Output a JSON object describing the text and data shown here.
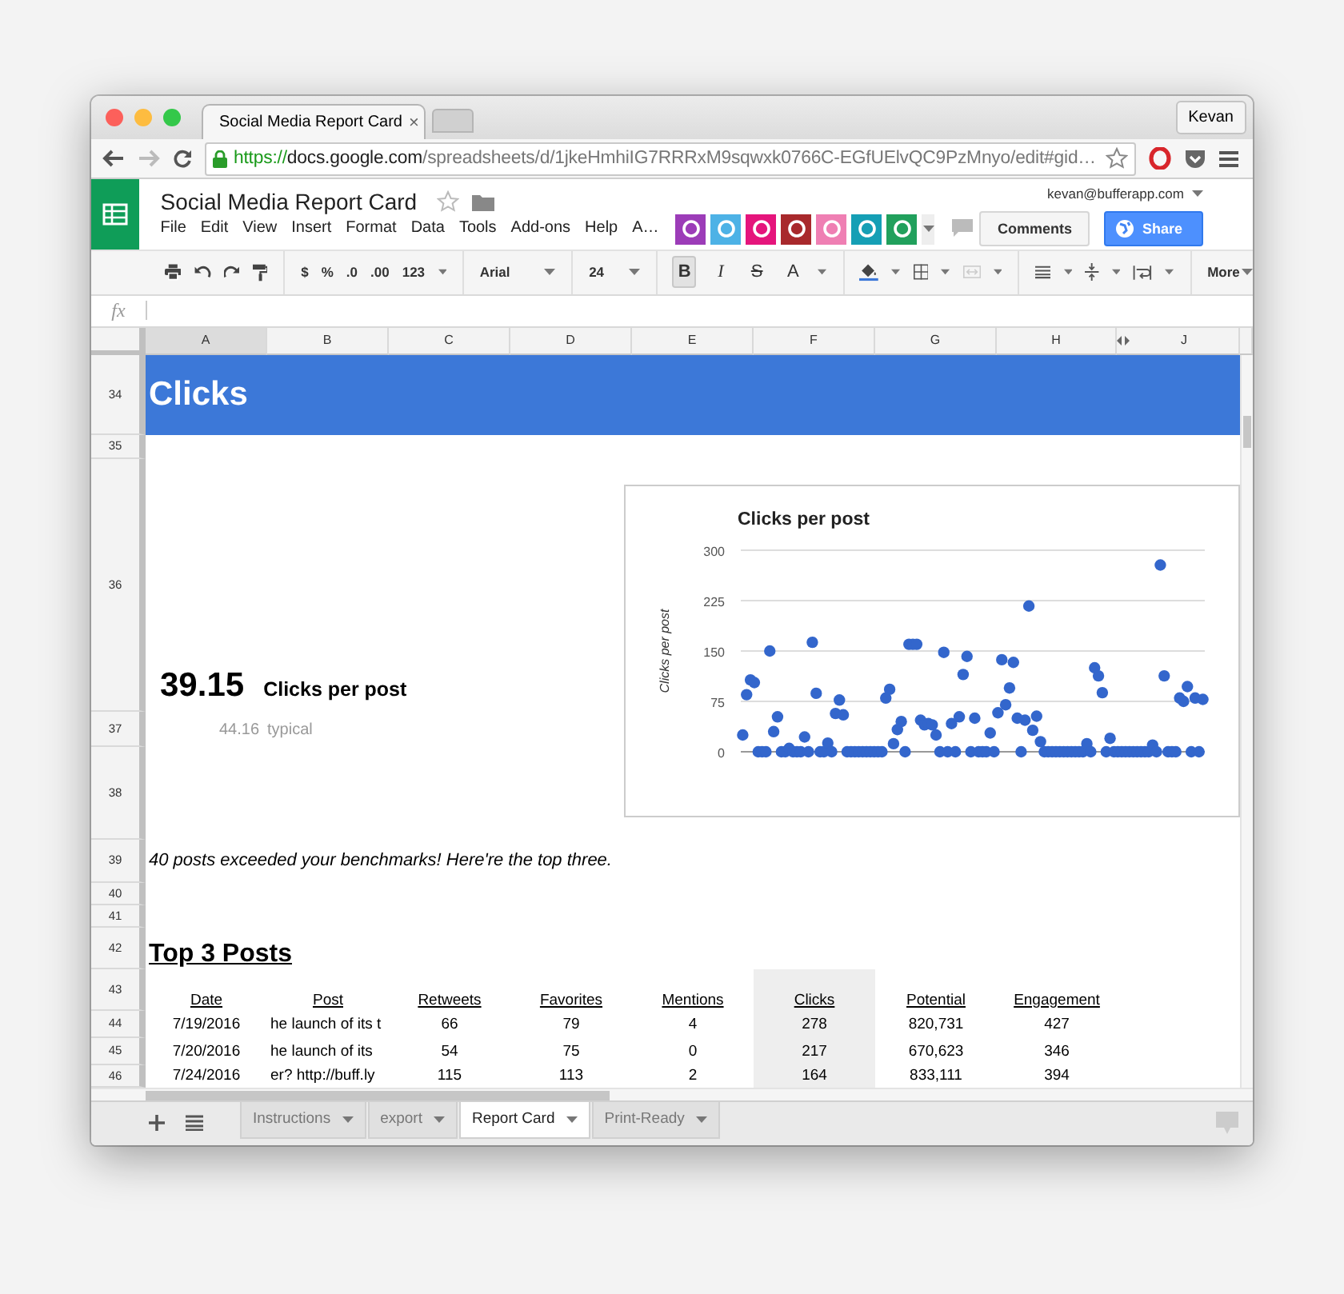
{
  "browser": {
    "tab_title": "Social Media Report Card",
    "tab_close": "×",
    "profile": "Kevan",
    "url": {
      "scheme": "https://",
      "host": "docs.google.com",
      "path": "/spreadsheets/d/1jkeHmhiIG7RRRxM9sqwxk0766C-EGfUElvQC9PzMnyo/edit#gid…"
    }
  },
  "doc": {
    "title": "Social Media Report Card",
    "account": "kevan@bufferapp.com",
    "menu": [
      "File",
      "Edit",
      "View",
      "Insert",
      "Format",
      "Data",
      "Tools",
      "Add-ons",
      "Help",
      "A…"
    ],
    "addons": [
      {
        "color": "#9c3cb8"
      },
      {
        "color": "#4db2e6"
      },
      {
        "color": "#e5157c"
      },
      {
        "color": "#a8292c"
      },
      {
        "color": "#ef7fb3"
      },
      {
        "color": "#159fb5"
      },
      {
        "color": "#21a05c"
      }
    ],
    "buttons": [
      {
        "label": "Comments",
        "kind": "plain"
      },
      {
        "label": "Share",
        "kind": "primary"
      }
    ]
  },
  "toolbar": {
    "number_formats": [
      "$",
      "%",
      ".0",
      ".00",
      "123"
    ],
    "font": "Arial",
    "font_size": "24",
    "text_styles": [
      {
        "kind": "bold",
        "label": "B",
        "on": true
      },
      {
        "kind": "italic",
        "label": "I",
        "on": false
      },
      {
        "kind": "strike",
        "label": "S",
        "on": false
      },
      {
        "kind": "color",
        "label": "A",
        "on": false
      }
    ],
    "more": "More"
  },
  "formula_bar": {
    "label": "fx"
  },
  "columns": [
    {
      "label": "A",
      "selected": true
    },
    {
      "label": "B",
      "selected": false
    },
    {
      "label": "C",
      "selected": false
    },
    {
      "label": "D",
      "selected": false
    },
    {
      "label": "E",
      "selected": false
    },
    {
      "label": "F",
      "selected": false
    },
    {
      "label": "G",
      "selected": false
    },
    {
      "label": "H",
      "selected": false
    },
    {
      "label": "J",
      "selected": false
    }
  ],
  "row_numbers": [
    "34",
    "35",
    "36",
    "37",
    "38",
    "39",
    "40",
    "41",
    "42",
    "43",
    "44",
    "45",
    "46"
  ],
  "section_title": "Clicks",
  "stat": {
    "value": "39.15",
    "label": "Clicks per post",
    "typical_value": "44.16",
    "typical_label": "typical"
  },
  "chart_data": {
    "type": "scatter",
    "title": "Clicks per post",
    "ylabel": "Clicks per post",
    "ylim": [
      0,
      300
    ],
    "grid": true,
    "yticks": [
      0,
      75,
      150,
      225,
      300
    ],
    "values": [
      25,
      85,
      107,
      103,
      0,
      0,
      0,
      150,
      30,
      52,
      0,
      0,
      5,
      0,
      0,
      0,
      22,
      0,
      163,
      87,
      0,
      0,
      13,
      0,
      57,
      77,
      55,
      0,
      0,
      0,
      0,
      0,
      0,
      0,
      0,
      0,
      0,
      80,
      93,
      12,
      33,
      45,
      0,
      160,
      160,
      160,
      47,
      40,
      42,
      40,
      25,
      0,
      148,
      0,
      42,
      0,
      52,
      115,
      142,
      0,
      50,
      0,
      0,
      0,
      28,
      0,
      58,
      137,
      70,
      95,
      133,
      50,
      0,
      47,
      217,
      32,
      53,
      15,
      0,
      0,
      0,
      0,
      0,
      0,
      0,
      0,
      0,
      0,
      0,
      12,
      0,
      125,
      113,
      88,
      0,
      20,
      0,
      0,
      0,
      0,
      0,
      0,
      0,
      0,
      0,
      0,
      10,
      0,
      278,
      113,
      0,
      0,
      0,
      80,
      75,
      97,
      0,
      80,
      0,
      78
    ]
  },
  "note": "40 posts exceeded your benchmarks! Here're the top three.",
  "top_posts": {
    "title": "Top 3 Posts",
    "columns": [
      {
        "label": "Date",
        "highlighted": false
      },
      {
        "label": "Post",
        "highlighted": false
      },
      {
        "label": "Retweets",
        "highlighted": false
      },
      {
        "label": "Favorites",
        "highlighted": false
      },
      {
        "label": "Mentions",
        "highlighted": false
      },
      {
        "label": "Clicks",
        "highlighted": true
      },
      {
        "label": "Potential",
        "highlighted": false
      },
      {
        "label": "Engagement",
        "highlighted": false
      }
    ],
    "rows": [
      [
        "7/19/2016",
        "he launch of its t",
        "66",
        "79",
        "4",
        "278",
        "820,731",
        "427"
      ],
      [
        "7/20/2016",
        "he launch of its",
        "54",
        "75",
        "0",
        "217",
        "670,623",
        "346"
      ],
      [
        "7/24/2016",
        "er? http://buff.ly",
        "115",
        "113",
        "2",
        "164",
        "833,111",
        "394"
      ]
    ]
  },
  "sheet_tabs": [
    {
      "label": "Instructions",
      "selected": false
    },
    {
      "label": "export",
      "selected": false
    },
    {
      "label": "Report Card",
      "selected": true
    },
    {
      "label": "Print-Ready",
      "selected": false
    }
  ]
}
